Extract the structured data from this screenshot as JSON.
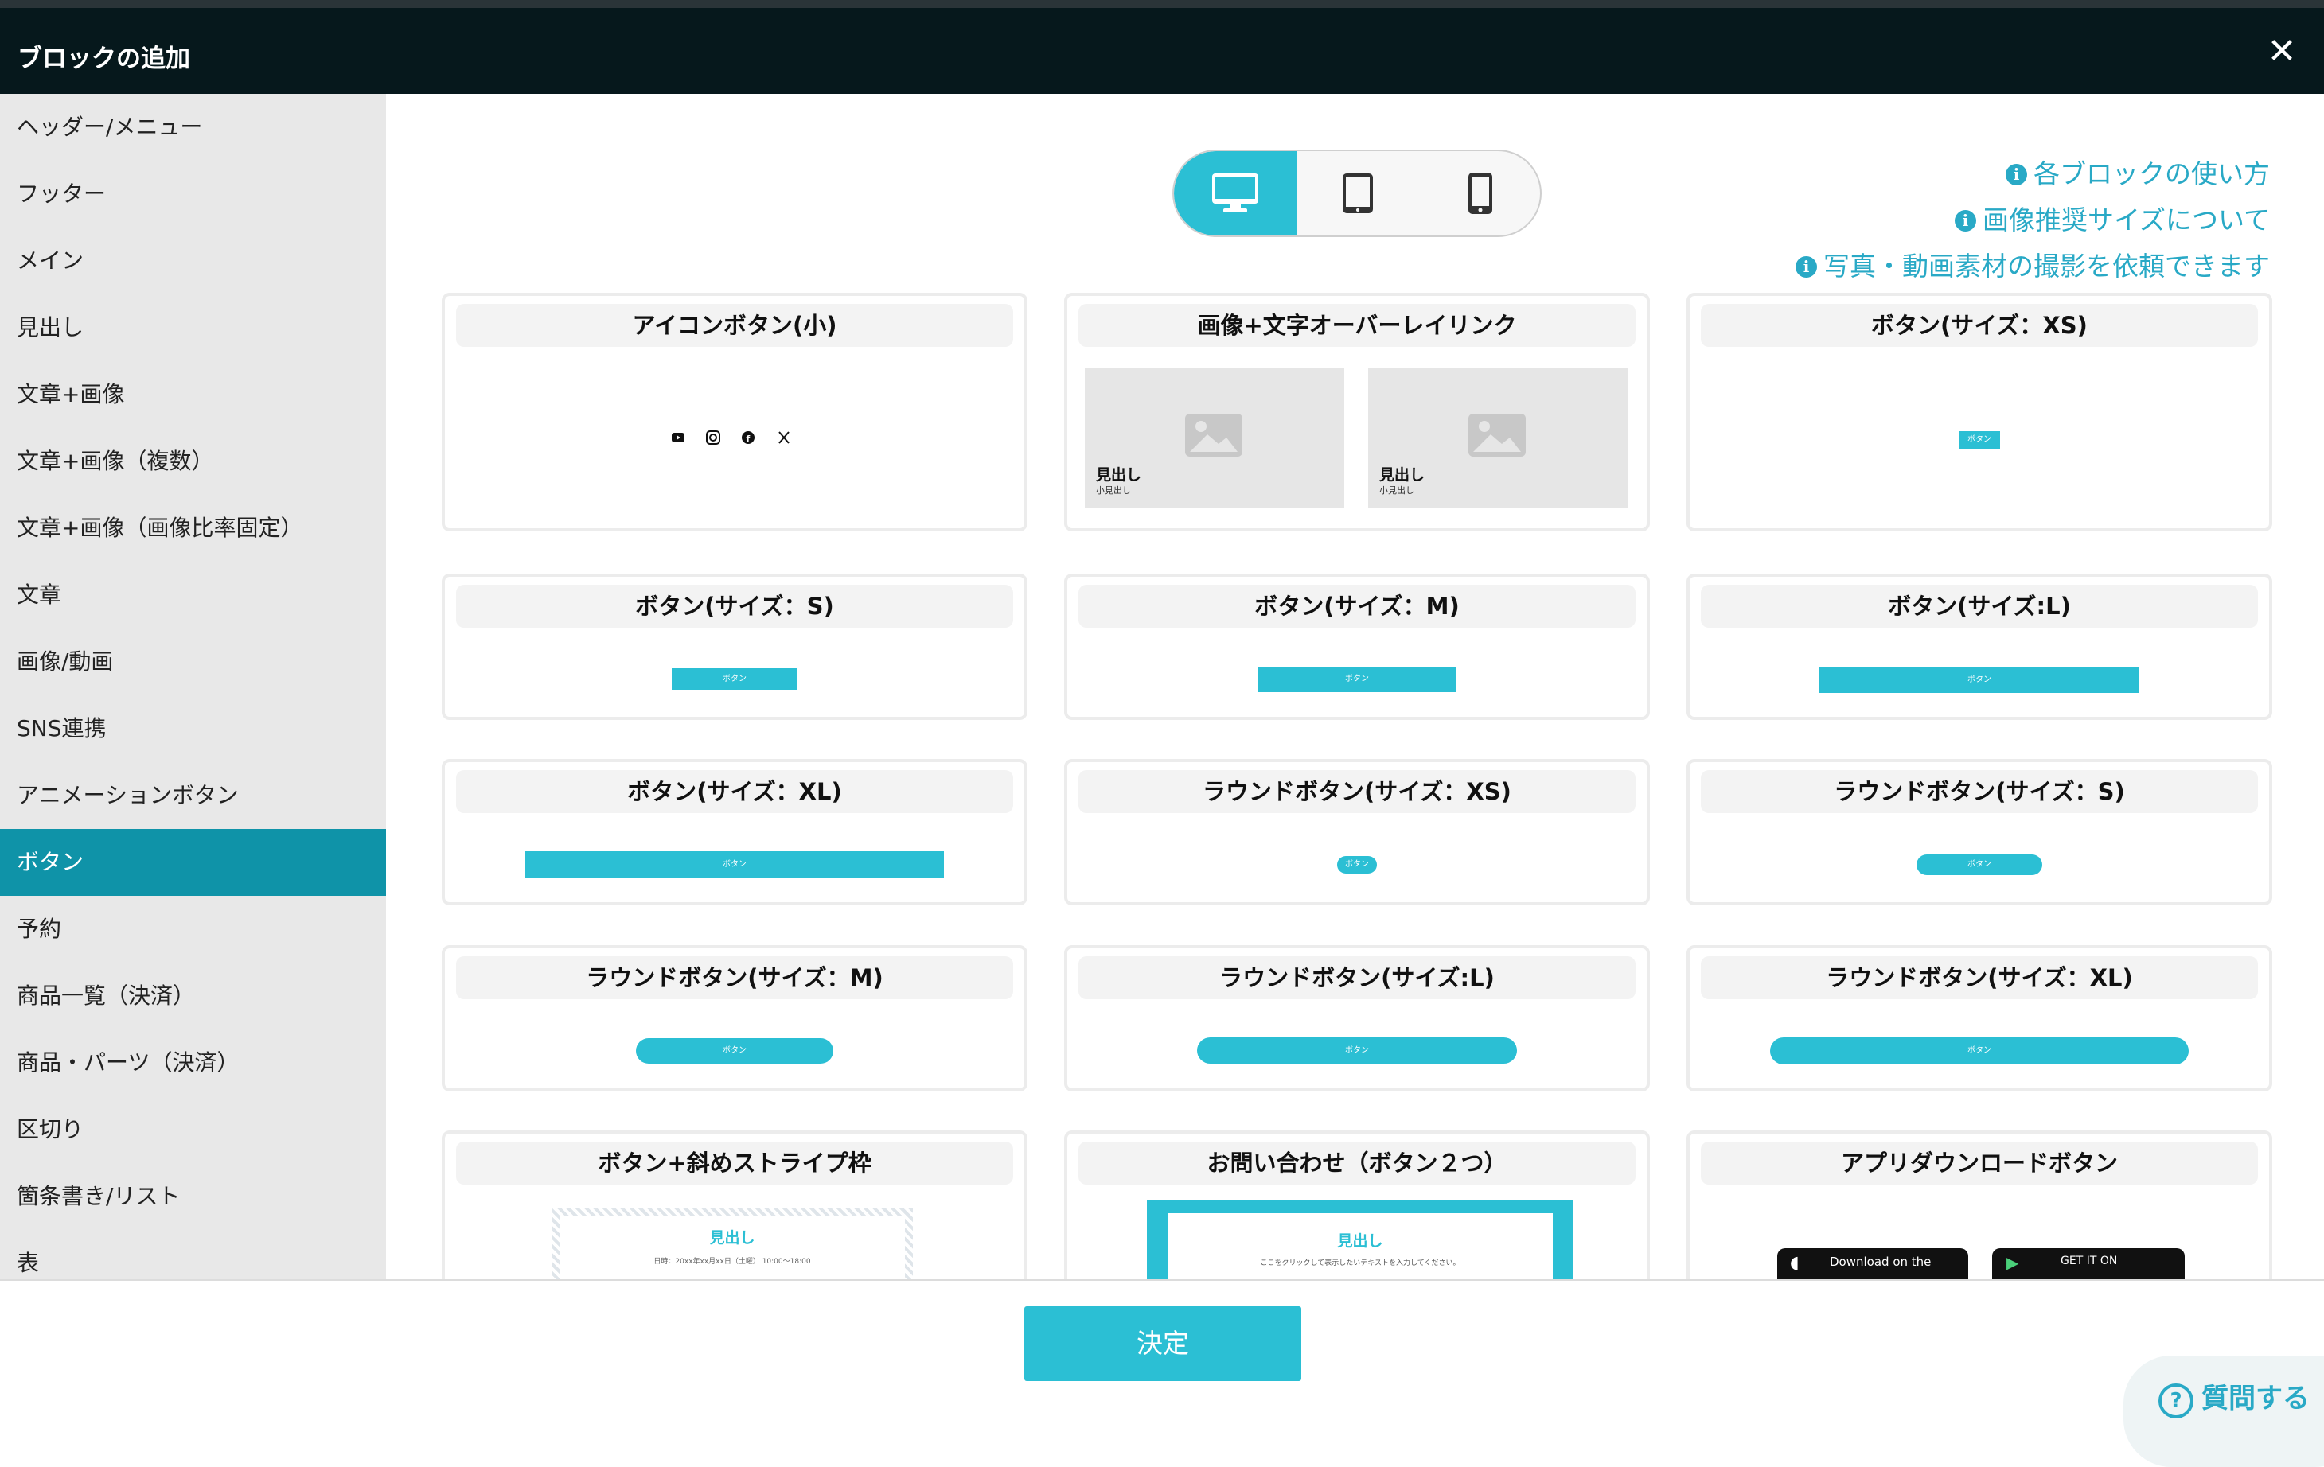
{
  "header": {
    "title": "ブロックの追加",
    "close_symbol": "✕"
  },
  "sidebar": {
    "items": [
      {
        "label": "ヘッダー/メニュー"
      },
      {
        "label": "フッター"
      },
      {
        "label": "メイン"
      },
      {
        "label": "見出し"
      },
      {
        "label": "文章+画像"
      },
      {
        "label": "文章+画像（複数）"
      },
      {
        "label": "文章+画像（画像比率固定）"
      },
      {
        "label": "文章"
      },
      {
        "label": "画像/動画"
      },
      {
        "label": "SNS連携"
      },
      {
        "label": "アニメーションボタン"
      },
      {
        "label": "ボタン",
        "active": true
      },
      {
        "label": "予約"
      },
      {
        "label": "商品一覧（決済）"
      },
      {
        "label": "商品・パーツ（決済）"
      },
      {
        "label": "区切り"
      },
      {
        "label": "箇条書き/リスト"
      },
      {
        "label": "表"
      }
    ]
  },
  "device_toggle": {
    "options": [
      "desktop-icon",
      "tablet-icon",
      "phone-icon"
    ],
    "selected": "desktop-icon"
  },
  "help_links": [
    {
      "label": "各ブロックの使い方"
    },
    {
      "label": "画像推奨サイズについて"
    },
    {
      "label": "写真・動画素材の撮影を依頼できます"
    }
  ],
  "cards": [
    {
      "title": "アイコンボタン(小)"
    },
    {
      "title": "画像+文字オーバーレイリンク",
      "preview": {
        "heading": "見出し",
        "subheading": "小見出し"
      }
    },
    {
      "title": "ボタン(サイズ：XS)",
      "button_label": "ボタン"
    },
    {
      "title": "ボタン(サイズ：S)",
      "button_label": "ボタン"
    },
    {
      "title": "ボタン(サイズ：M)",
      "button_label": "ボタン"
    },
    {
      "title": "ボタン(サイズ:L)",
      "button_label": "ボタン"
    },
    {
      "title": "ボタン(サイズ：XL)",
      "button_label": "ボタン"
    },
    {
      "title": "ラウンドボタン(サイズ：XS)",
      "button_label": "ボタン"
    },
    {
      "title": "ラウンドボタン(サイズ：S)",
      "button_label": "ボタン"
    },
    {
      "title": "ラウンドボタン(サイズ：M)",
      "button_label": "ボタン"
    },
    {
      "title": "ラウンドボタン(サイズ:L)",
      "button_label": "ボタン"
    },
    {
      "title": "ラウンドボタン(サイズ：XL)",
      "button_label": "ボタン"
    },
    {
      "title": "ボタン+斜めストライプ枠",
      "preview": {
        "heading": "見出し",
        "text": "日時：20xx年xx月xx日（土曜） 10:00〜18:00"
      }
    },
    {
      "title": "お問い合わせ（ボタン２つ）",
      "preview": {
        "heading": "見出し",
        "text": "ここをクリックして表示したいテキストを入力してください。"
      }
    },
    {
      "title": "アプリダウンロードボタン",
      "preview": {
        "apple": "Download on the",
        "google": "GET IT ON"
      }
    }
  ],
  "footer": {
    "confirm_label": "決定",
    "ask_label": "質問する",
    "ask_icon_symbol": "?"
  },
  "colors": {
    "accent": "#2bbfd4",
    "header_bg": "#06181c",
    "sidebar_active": "#0f93a8",
    "link": "#29a9c6"
  }
}
